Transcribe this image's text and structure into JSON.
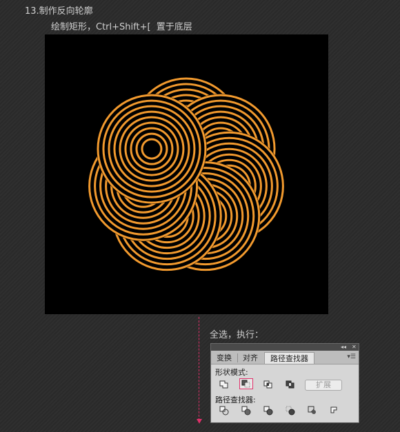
{
  "step": {
    "title": "13.制作反向轮廓",
    "instruction": "绘制矩形，Ctrl+Shift+[  置于底层"
  },
  "artwork": {
    "background": "#000000",
    "stroke_color": "#f29a2e",
    "ring_count": 7,
    "rings_per_circle": 9
  },
  "caption": "全选，执行：",
  "panel": {
    "controls": {
      "collapse": "◂◂",
      "close": "✕"
    },
    "tabs": [
      {
        "label": "变换"
      },
      {
        "label": "对齐"
      },
      {
        "label": "路径查找器"
      }
    ],
    "active_tab": "路径查找器",
    "menu_icon": "panel-menu-icon",
    "shape_modes_label": "形状模式:",
    "shape_modes": [
      "unite-icon",
      "minus-front-icon",
      "intersect-icon",
      "exclude-icon"
    ],
    "selected_shape_mode": "minus-front-icon",
    "expand_label": "扩展",
    "pathfinders_label": "路径查找器:",
    "pathfinders": [
      "divide-icon",
      "trim-icon",
      "merge-icon",
      "crop-icon",
      "outline-icon",
      "minus-back-icon"
    ]
  },
  "accent_color": "#e0306a"
}
